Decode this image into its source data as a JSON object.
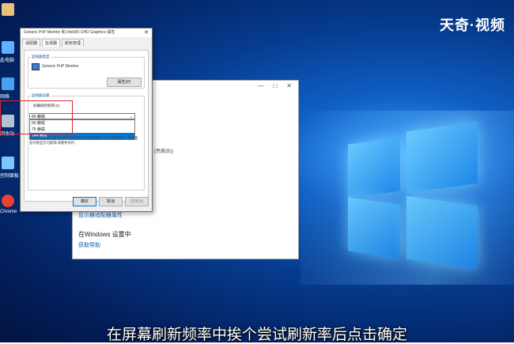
{
  "watermark": "天奇·视频",
  "desktop_icons": [
    {
      "label": "",
      "icon": "user-folder-icon",
      "color": "#e8c27a"
    },
    {
      "label": "此电脑",
      "icon": "computer-icon",
      "color": "#5fb0ff"
    },
    {
      "label": "网络",
      "icon": "network-icon",
      "color": "#4aa0f0"
    },
    {
      "label": "回收站",
      "icon": "recycle-bin-icon",
      "color": "#b0c4d6"
    },
    {
      "label": "控制面板",
      "icon": "control-panel-icon",
      "color": "#7dc6ff"
    },
    {
      "label": "Chrome",
      "icon": "chrome-icon",
      "color": "#e94235"
    }
  ],
  "bg_window": {
    "min": "—",
    "max": "□",
    "close": "✕",
    "small_text": "(亮度(B))",
    "link1": "显示器适配器属性",
    "head": "在Windows 设置中",
    "link2": "获取帮助"
  },
  "dialog": {
    "title": "Generic PnP Monitor 和 Intel(R) UHD Graphics 属性",
    "close": "✕",
    "tabs": [
      "适配器",
      "监视器",
      "颜色管理"
    ],
    "monitor_group_label": "监视器类型",
    "monitor_name": "Generic PnP Monitor",
    "properties_button": "属性(P)",
    "settings_group_label": "监视器设置",
    "refresh_label": "屏幕刷新频率(S):",
    "selected_value": "60 赫兹",
    "options": [
      "60 赫兹",
      "75 赫兹",
      "144 赫兹"
    ],
    "selected_index": 2,
    "warning": "清除此复选框可使你选择的显示模式在该监视器上无法正确显示。这可能会导致显示问题和/或硬件损坏。",
    "ok": "确定",
    "cancel": "取消",
    "apply": "应用(A)"
  },
  "subtitle": "在屏幕刷新频率中挨个尝试刷新率后点击确定"
}
